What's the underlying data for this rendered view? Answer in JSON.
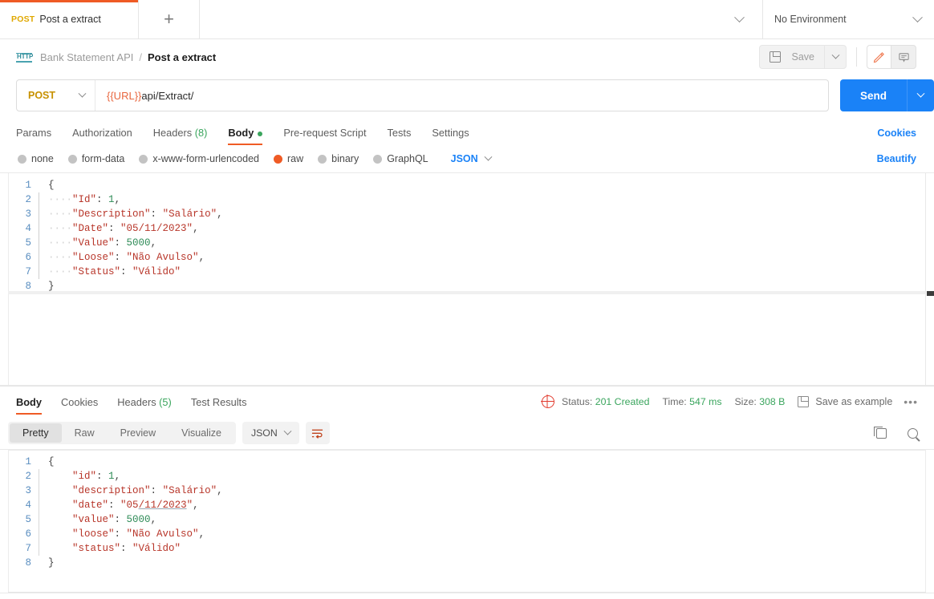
{
  "tabstrip": {
    "tab": {
      "method": "POST",
      "name": "Post a extract"
    },
    "add_label": "+",
    "environment": {
      "label": "No Environment"
    }
  },
  "breadcrumb": {
    "icon": "http-icon",
    "parent": "Bank Statement API",
    "separator": "/",
    "current": "Post a extract"
  },
  "actions": {
    "save_label": "Save",
    "edit_icon": "pencil-icon",
    "comment_icon": "comment-icon"
  },
  "url_bar": {
    "method": "POST",
    "url_variable": "{{URL}}",
    "url_path": "api/Extract/",
    "send_label": "Send"
  },
  "request_tabs": [
    {
      "label": "Params",
      "active": false
    },
    {
      "label": "Authorization",
      "active": false
    },
    {
      "label": "Headers",
      "count": "(8)",
      "active": false
    },
    {
      "label": "Body",
      "active": true,
      "dot": true
    },
    {
      "label": "Pre-request Script",
      "active": false
    },
    {
      "label": "Tests",
      "active": false
    },
    {
      "label": "Settings",
      "active": false
    }
  ],
  "cookies_link": "Cookies",
  "body_types": [
    {
      "label": "none",
      "selected": false
    },
    {
      "label": "form-data",
      "selected": false
    },
    {
      "label": "x-www-form-urlencoded",
      "selected": false
    },
    {
      "label": "raw",
      "selected": true
    },
    {
      "label": "binary",
      "selected": false
    },
    {
      "label": "GraphQL",
      "selected": false
    }
  ],
  "body_format": "JSON",
  "beautify_label": "Beautify",
  "request_body": {
    "line_numbers": [
      "1",
      "2",
      "3",
      "4",
      "5",
      "6",
      "7",
      "8"
    ],
    "lines": [
      {
        "open": "{"
      },
      {
        "key": "\"Id\"",
        "colon": ": ",
        "num": "1",
        "comma": ","
      },
      {
        "key": "\"Description\"",
        "colon": ": ",
        "str": "\"Salário\"",
        "comma": ","
      },
      {
        "key": "\"Date\"",
        "colon": ": ",
        "str": "\"05/11/2023\"",
        "comma": ","
      },
      {
        "key": "\"Value\"",
        "colon": ": ",
        "num": "5000",
        "comma": ","
      },
      {
        "key": "\"Loose\"",
        "colon": ": ",
        "str": "\"Não Avulso\"",
        "comma": ","
      },
      {
        "key": "\"Status\"",
        "colon": ": ",
        "str": "\"Válido\"",
        "comma": ""
      },
      {
        "close": "}"
      }
    ]
  },
  "response_tabs": [
    {
      "label": "Body",
      "active": true
    },
    {
      "label": "Cookies",
      "active": false
    },
    {
      "label": "Headers",
      "count": "(5)",
      "active": false
    },
    {
      "label": "Test Results",
      "active": false
    }
  ],
  "response_meta": {
    "status_label": "Status:",
    "status_value": "201 Created",
    "time_label": "Time:",
    "time_value": "547 ms",
    "size_label": "Size:",
    "size_value": "308 B",
    "save_as_example": "Save as example",
    "more": "•••"
  },
  "response_views": [
    {
      "label": "Pretty",
      "active": true
    },
    {
      "label": "Raw",
      "active": false
    },
    {
      "label": "Preview",
      "active": false
    },
    {
      "label": "Visualize",
      "active": false
    }
  ],
  "response_format": "JSON",
  "response_body": {
    "line_numbers": [
      "1",
      "2",
      "3",
      "4",
      "5",
      "6",
      "7",
      "8"
    ],
    "lines": [
      {
        "open": "{"
      },
      {
        "key": "\"id\"",
        "colon": ": ",
        "num": "1",
        "comma": ","
      },
      {
        "key": "\"description\"",
        "colon": ": ",
        "str": "\"Salário\"",
        "comma": ","
      },
      {
        "key": "\"date\"",
        "colon": ": ",
        "str_pre": "\"05",
        "str_link": "/11/2023",
        "str_post": "\"",
        "comma": ","
      },
      {
        "key": "\"value\"",
        "colon": ": ",
        "num": "5000",
        "comma": ","
      },
      {
        "key": "\"loose\"",
        "colon": ": ",
        "str": "\"Não Avulso\"",
        "comma": ","
      },
      {
        "key": "\"status\"",
        "colon": ": ",
        "str": "\"Válido\"",
        "comma": ""
      },
      {
        "close": "}"
      }
    ]
  },
  "colors": {
    "accent_orange": "#ef5b25",
    "blue": "#1a82f7",
    "green": "#3aa55d",
    "method_yellow": "#c79100",
    "string_red": "#b8362a"
  }
}
